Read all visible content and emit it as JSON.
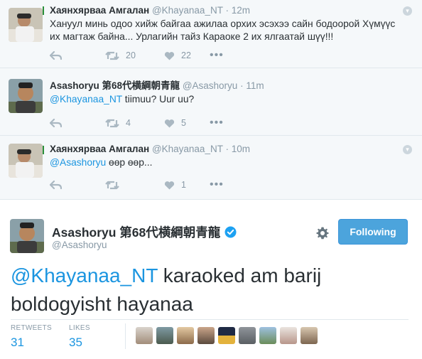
{
  "thread": [
    {
      "name": "Хаянхярваа Амгалан",
      "handle": "@Khayanaa_NT",
      "separator": "·",
      "time": "12m",
      "text": "Хануул минь одоо хийж байгаа ажилаа орхих эсэхээ сайн бодоорой Хүмүүс их магтаж байна... Урлагийн тайз Караоке 2 их ялгаатай шүү!!!",
      "mention": "",
      "retweets": "20",
      "likes": "22"
    },
    {
      "name": "Asashoryu 第68代横綱朝青龍",
      "handle": "@Asashoryu",
      "separator": "·",
      "time": "11m",
      "mention": "@Khayanaa_NT",
      "text": " tiimuu? Uur uu?",
      "retweets": "4",
      "likes": "5"
    },
    {
      "name": "Хаянхярваа Амгалан",
      "handle": "@Khayanaa_NT",
      "separator": "·",
      "time": "10m",
      "mention": "@Asashoryu",
      "text": " өөр өөр...",
      "retweets": "",
      "likes": "1"
    }
  ],
  "main_tweet": {
    "name": "Asashoryu 第68代横綱朝青龍",
    "handle": "@Asashoryu",
    "follow_label": "Following",
    "mention": "@Khayanaa_NT",
    "text": " karaoked am barij boldogyisht hayanaa",
    "retweets_label": "RETWEETS",
    "retweets_count": "31",
    "likes_label": "LIKES",
    "likes_count": "35"
  },
  "colors": {
    "link": "#1b95e0",
    "follow_button": "#4ca4dc",
    "thread_bg": "#f5f8fa",
    "muted": "#8899a6"
  },
  "icons": [
    "reply-icon",
    "retweet-icon",
    "like-icon",
    "more-icon",
    "caret-down-icon",
    "verified-badge-icon",
    "gear-icon"
  ]
}
